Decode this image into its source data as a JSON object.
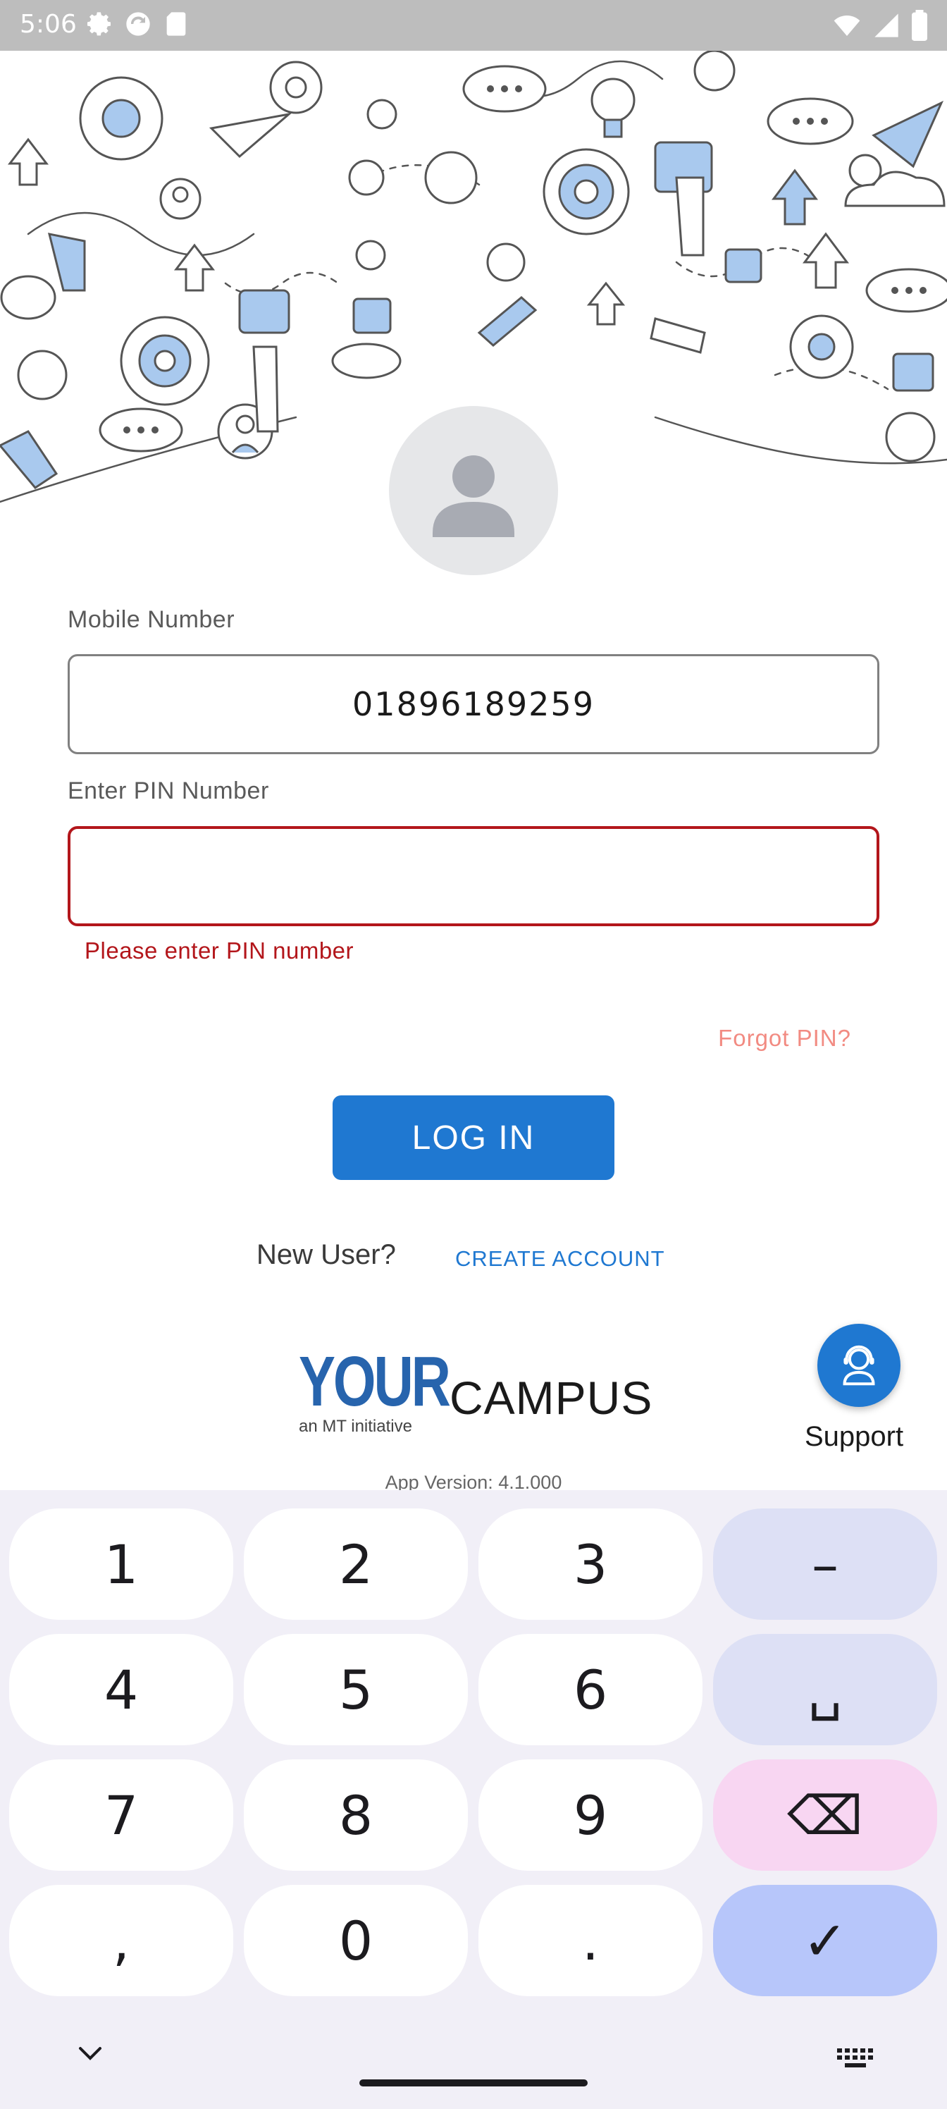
{
  "status_bar": {
    "time": "5:06",
    "left_icons": [
      "settings-icon",
      "sync-icon",
      "sd-card-icon"
    ],
    "right_icons": [
      "wifi-icon",
      "signal-icon",
      "battery-icon"
    ]
  },
  "form": {
    "mobile_label": "Mobile Number",
    "mobile_value": "01896189259",
    "pin_label": "Enter PIN Number",
    "pin_value": "",
    "pin_error": "Please enter PIN number",
    "forgot_pin": "Forgot PIN?",
    "login_label": "LOG IN",
    "new_user_text": "New User?",
    "create_account_label": "CREATE ACCOUNT"
  },
  "branding": {
    "logo_your": "YOUR",
    "logo_campus": "CAMPUS",
    "logo_tagline": "an MT initiative",
    "app_version": "App Version: 4.1.000"
  },
  "support": {
    "label": "Support",
    "icon": "support-agent-icon"
  },
  "keyboard": {
    "rows": [
      [
        "1",
        "2",
        "3",
        "–"
      ],
      [
        "4",
        "5",
        "6",
        "␣"
      ],
      [
        "7",
        "8",
        "9",
        "⌫"
      ],
      [
        ",",
        "0",
        ".",
        "✓"
      ]
    ]
  },
  "colors": {
    "accent": "#1f78d1",
    "error": "#b3161b",
    "forgot": "#f28b82",
    "doodle_blue": "#a9c9ee"
  }
}
